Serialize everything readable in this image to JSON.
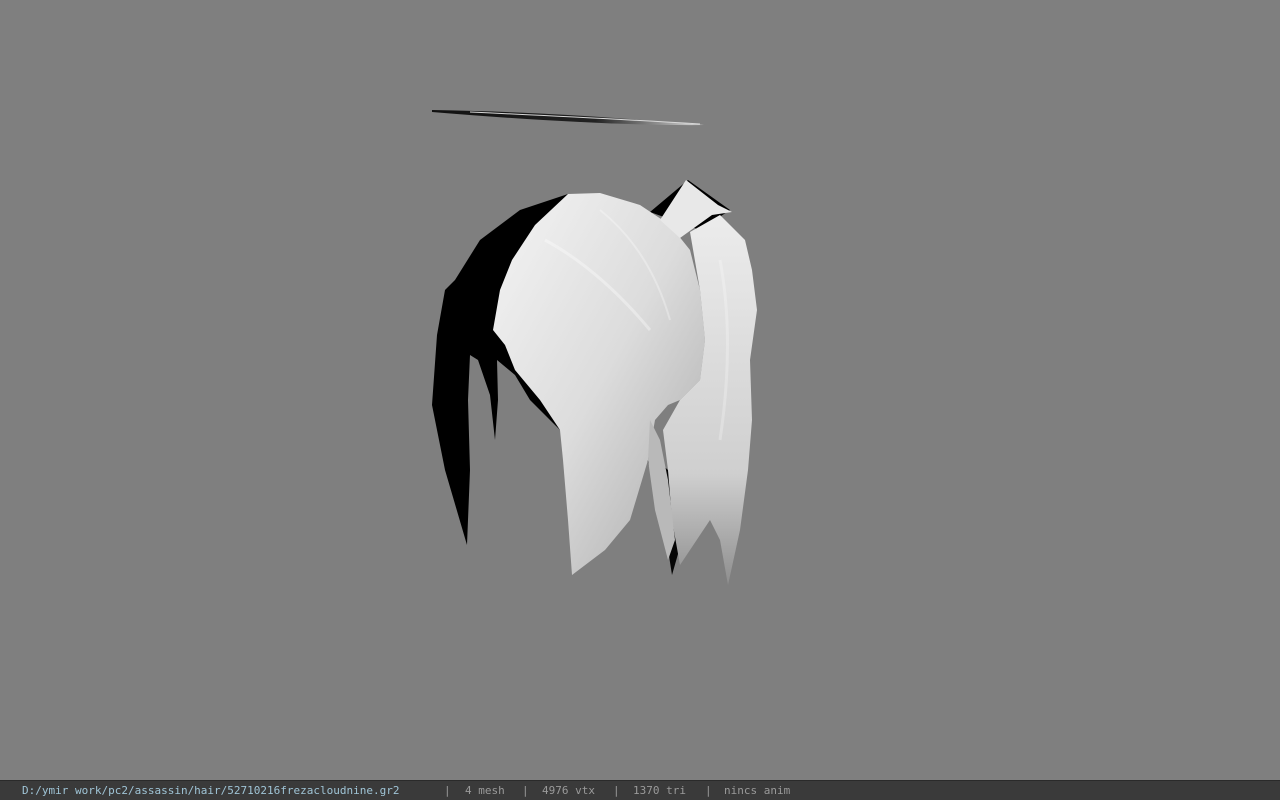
{
  "viewer": {
    "background_color": "#7f7f7f",
    "model": "hair mesh with halo ring"
  },
  "status_bar": {
    "file_path": "D:/ymir work/pc2/assassin/hair/52710216frezacloudnine.gr2",
    "separator": "|",
    "mesh_count": "4 mesh",
    "vertex_count": "4976 vtx",
    "triangle_count": "1370 tri",
    "anim_status": "nincs anim",
    "path_color": "#9fc4d6",
    "text_color": "#9a9a9a",
    "bar_color": "#3a3a3a"
  }
}
